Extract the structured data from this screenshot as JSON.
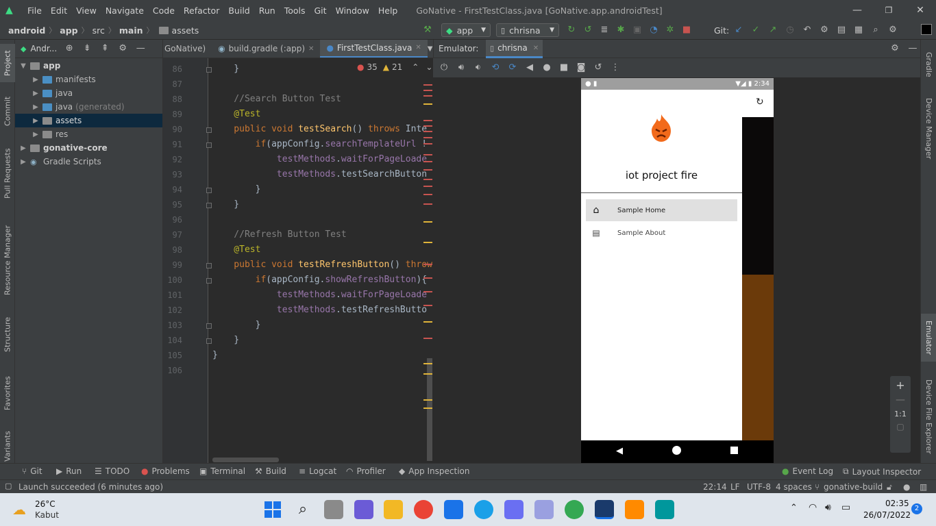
{
  "window": {
    "menu": [
      "File",
      "Edit",
      "View",
      "Navigate",
      "Code",
      "Refactor",
      "Build",
      "Run",
      "Tools",
      "Git",
      "Window",
      "Help"
    ],
    "title": "GoNative - FirstTestClass.java [GoNative.app.androidTest]",
    "minimize": "—",
    "restore": "❐",
    "close": "✕"
  },
  "nav": {
    "breadcrumbs": [
      "android",
      "app",
      "src",
      "main",
      "assets"
    ],
    "run_config": "app",
    "device": "chrisna",
    "git_label": "Git:"
  },
  "left_stripe": [
    "Project",
    "Commit",
    "Pull Requests",
    "Resource Manager",
    "Structure",
    "Favorites",
    "Variants"
  ],
  "right_stripe": [
    "Gradle",
    "Device Manager",
    "Emulator",
    "Device File Explorer"
  ],
  "project": {
    "header": "Andr...",
    "tree": [
      {
        "label": "app",
        "bold": true,
        "indent": 0,
        "expanded": true
      },
      {
        "label": "manifests",
        "indent": 1
      },
      {
        "label": "java",
        "indent": 1
      },
      {
        "label": "java",
        "suffix": "(generated)",
        "indent": 1
      },
      {
        "label": "assets",
        "indent": 1,
        "selected": true
      },
      {
        "label": "res",
        "indent": 1
      },
      {
        "label": "gonative-core",
        "bold": true,
        "indent": 0
      },
      {
        "label": "Gradle Scripts",
        "indent": 0
      }
    ]
  },
  "editor": {
    "tabs": [
      "GoNative)",
      "build.gradle (:app)",
      "FirstTestClass.java"
    ],
    "errors": "35",
    "warnings": "21",
    "line_numbers": [
      "86",
      "87",
      "88",
      "89",
      "90",
      "91",
      "92",
      "93",
      "94",
      "95",
      "96",
      "97",
      "98",
      "99",
      "100",
      "101",
      "102",
      "103",
      "104",
      "105",
      "106"
    ]
  },
  "emulator": {
    "header_label": "Emulator:",
    "device_tab": "chrisna",
    "time": "2:34",
    "app_name": "iot project fire",
    "menu_items": [
      "Sample Home",
      "Sample About"
    ],
    "zoom": "1:1"
  },
  "bottom_tools": [
    "Git",
    "Run",
    "TODO",
    "Problems",
    "Terminal",
    "Build",
    "Logcat",
    "Profiler",
    "App Inspection"
  ],
  "bottom_right_tools": [
    "Event Log",
    "Layout Inspector"
  ],
  "status": {
    "message": "Launch succeeded (6 minutes ago)",
    "position": "22:14",
    "line_sep": "LF",
    "encoding": "UTF-8",
    "indent": "4 spaces",
    "branch": "gonative-build"
  },
  "taskbar": {
    "temp": "26°C",
    "weather": "Kabut",
    "clock": "02:35",
    "date": "26/07/2022",
    "notifications": "2"
  }
}
